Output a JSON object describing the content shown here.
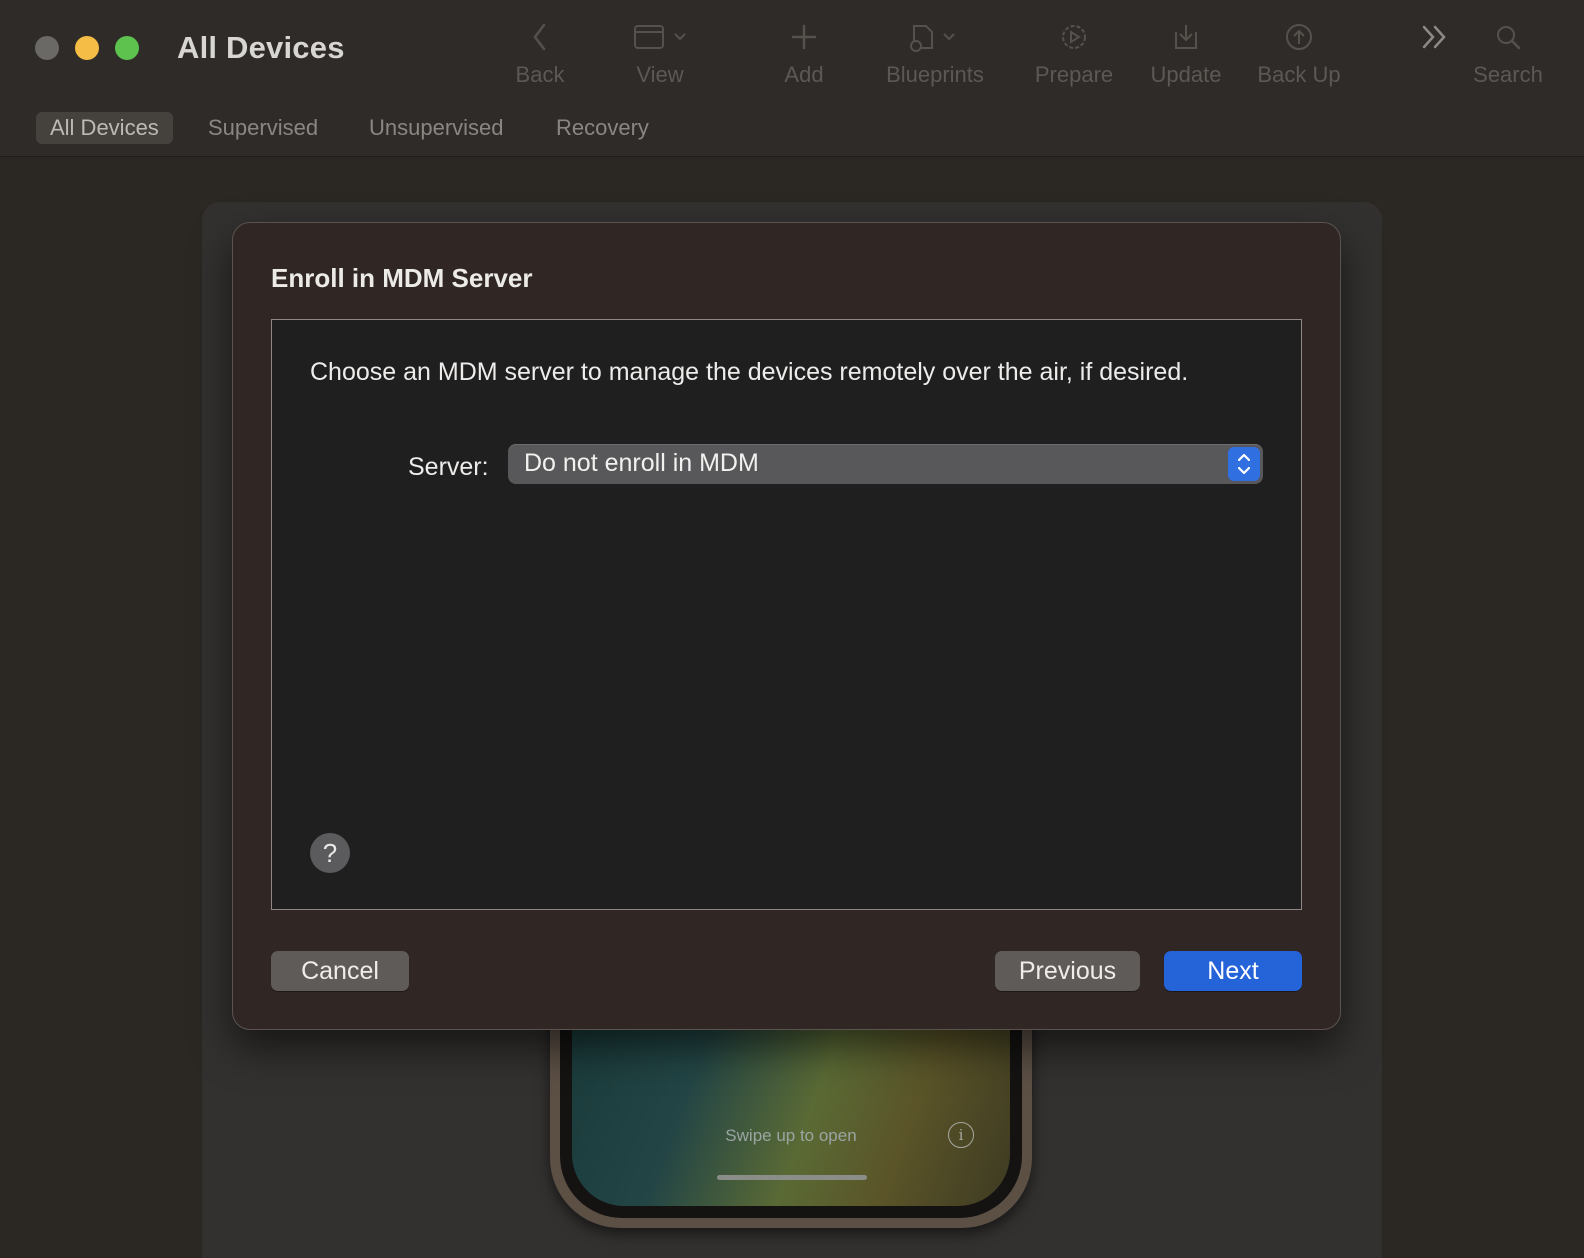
{
  "window": {
    "title": "All Devices"
  },
  "toolbar": {
    "items": [
      {
        "label": "Back",
        "icon": "chevron-left-icon"
      },
      {
        "label": "View",
        "icon": "window-view-icon"
      },
      {
        "label": "Add",
        "icon": "plus-icon"
      },
      {
        "label": "Blueprints",
        "icon": "blueprint-icon"
      },
      {
        "label": "Prepare",
        "icon": "prepare-gear-icon"
      },
      {
        "label": "Update",
        "icon": "update-download-icon"
      },
      {
        "label": "Back Up",
        "icon": "backup-arrow-icon"
      },
      {
        "label": "Search",
        "icon": "search-icon"
      }
    ]
  },
  "scopes": {
    "items": [
      "All Devices",
      "Supervised",
      "Unsupervised",
      "Recovery"
    ],
    "selected": "All Devices"
  },
  "phone": {
    "lock_text": "Swipe up to open",
    "info_glyph": "i"
  },
  "dialog": {
    "title": "Enroll in MDM Server",
    "description": "Choose an MDM server to manage the devices remotely over the air, if desired.",
    "server_label": "Server:",
    "server_value": "Do not enroll in MDM",
    "help_glyph": "?",
    "cancel_label": "Cancel",
    "previous_label": "Previous",
    "next_label": "Next"
  },
  "colors": {
    "accent": "#2563d9",
    "traffic_close": "#6b6966",
    "traffic_minimize": "#f5bd45",
    "traffic_maximize": "#5ec24f"
  }
}
